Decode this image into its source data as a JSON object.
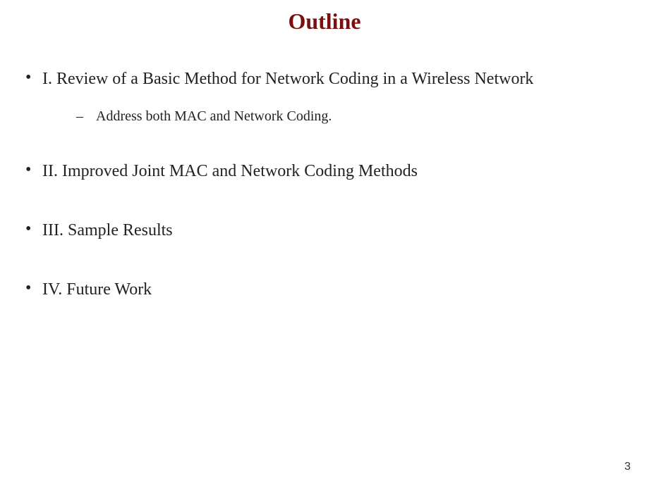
{
  "title": "Outline",
  "items": [
    {
      "text": "I. Review of a Basic Method for Network Coding in a Wireless Network",
      "subitems": [
        {
          "text": "Address both MAC and Network Coding."
        }
      ]
    },
    {
      "text": "II. Improved Joint MAC and Network Coding Methods"
    },
    {
      "text": "III. Sample Results"
    },
    {
      "text": "IV. Future Work"
    }
  ],
  "page_number": "3"
}
